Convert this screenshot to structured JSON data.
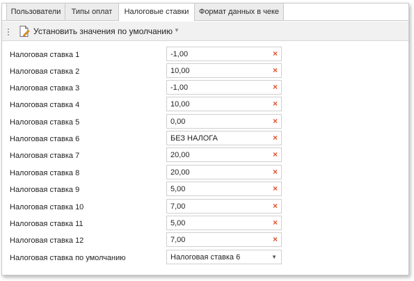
{
  "tabs": [
    {
      "label": "Пользователи"
    },
    {
      "label": "Типы оплат"
    },
    {
      "label": "Налоговые ставки"
    },
    {
      "label": "Формат данных в чеке"
    }
  ],
  "toolbar": {
    "set_defaults_label": "Установить значения по умолчанию"
  },
  "rates": [
    {
      "label": "Налоговая ставка 1",
      "value": "-1,00"
    },
    {
      "label": "Налоговая ставка 2",
      "value": "10,00"
    },
    {
      "label": "Налоговая ставка 3",
      "value": "-1,00"
    },
    {
      "label": "Налоговая ставка 4",
      "value": "10,00"
    },
    {
      "label": "Налоговая ставка 5",
      "value": "0,00"
    },
    {
      "label": "Налоговая ставка 6",
      "value": "БЕЗ НАЛОГА"
    },
    {
      "label": "Налоговая ставка 7",
      "value": "20,00"
    },
    {
      "label": "Налоговая ставка 8",
      "value": "20,00"
    },
    {
      "label": "Налоговая ставка 9",
      "value": "5,00"
    },
    {
      "label": "Налоговая ставка 10",
      "value": "7,00"
    },
    {
      "label": "Налоговая ставка 11",
      "value": "5,00"
    },
    {
      "label": "Налоговая ставка 12",
      "value": "7,00"
    }
  ],
  "default_rate": {
    "label": "Налоговая ставка по умолчанию",
    "value": "Налоговая ставка 6"
  },
  "colors": {
    "clear_icon": "#e3502b",
    "toolbar_bg": "#f1f1f1",
    "border": "#c9c9c9"
  }
}
